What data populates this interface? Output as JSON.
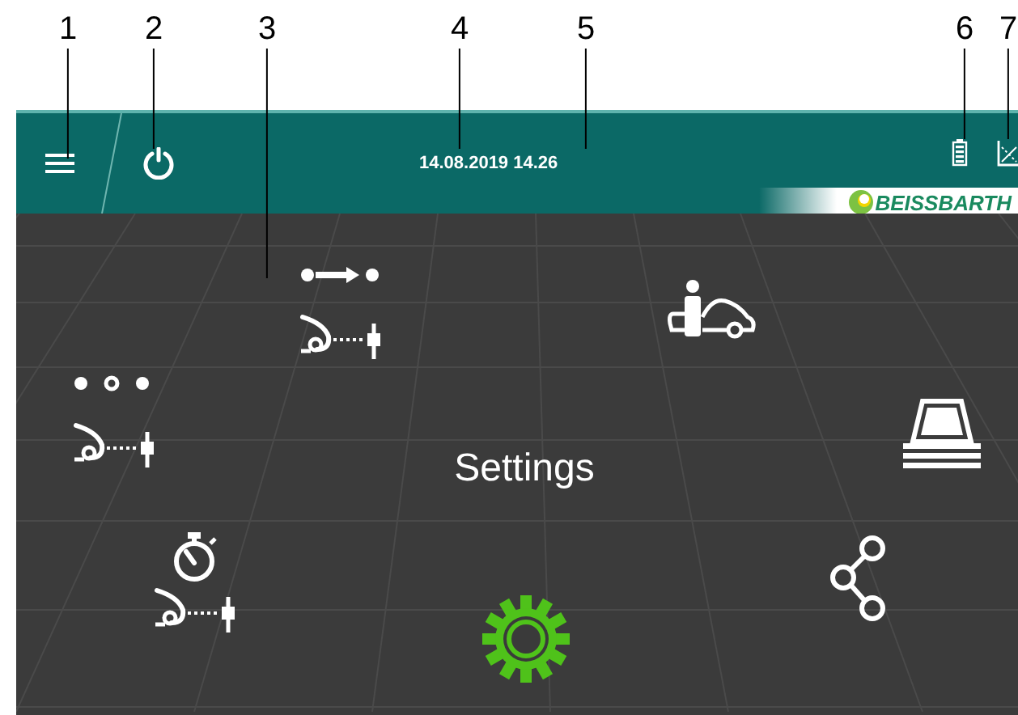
{
  "callouts": [
    {
      "label": "1"
    },
    {
      "label": "2"
    },
    {
      "label": "3"
    },
    {
      "label": "4"
    },
    {
      "label": "5"
    },
    {
      "label": "6"
    },
    {
      "label": "7"
    }
  ],
  "header": {
    "datetime": "14.08.2019 14.26",
    "logo": "BEISSBARTH"
  },
  "carousel": {
    "title": "Settings",
    "items": [
      {
        "kind": "measure-flow",
        "selected": false
      },
      {
        "kind": "customer-vehicle",
        "selected": false
      },
      {
        "kind": "measure-setup",
        "selected": false
      },
      {
        "kind": "database",
        "selected": false
      },
      {
        "kind": "measure-timed",
        "selected": false
      },
      {
        "kind": "settings",
        "selected": true
      },
      {
        "kind": "network",
        "selected": false
      }
    ]
  }
}
